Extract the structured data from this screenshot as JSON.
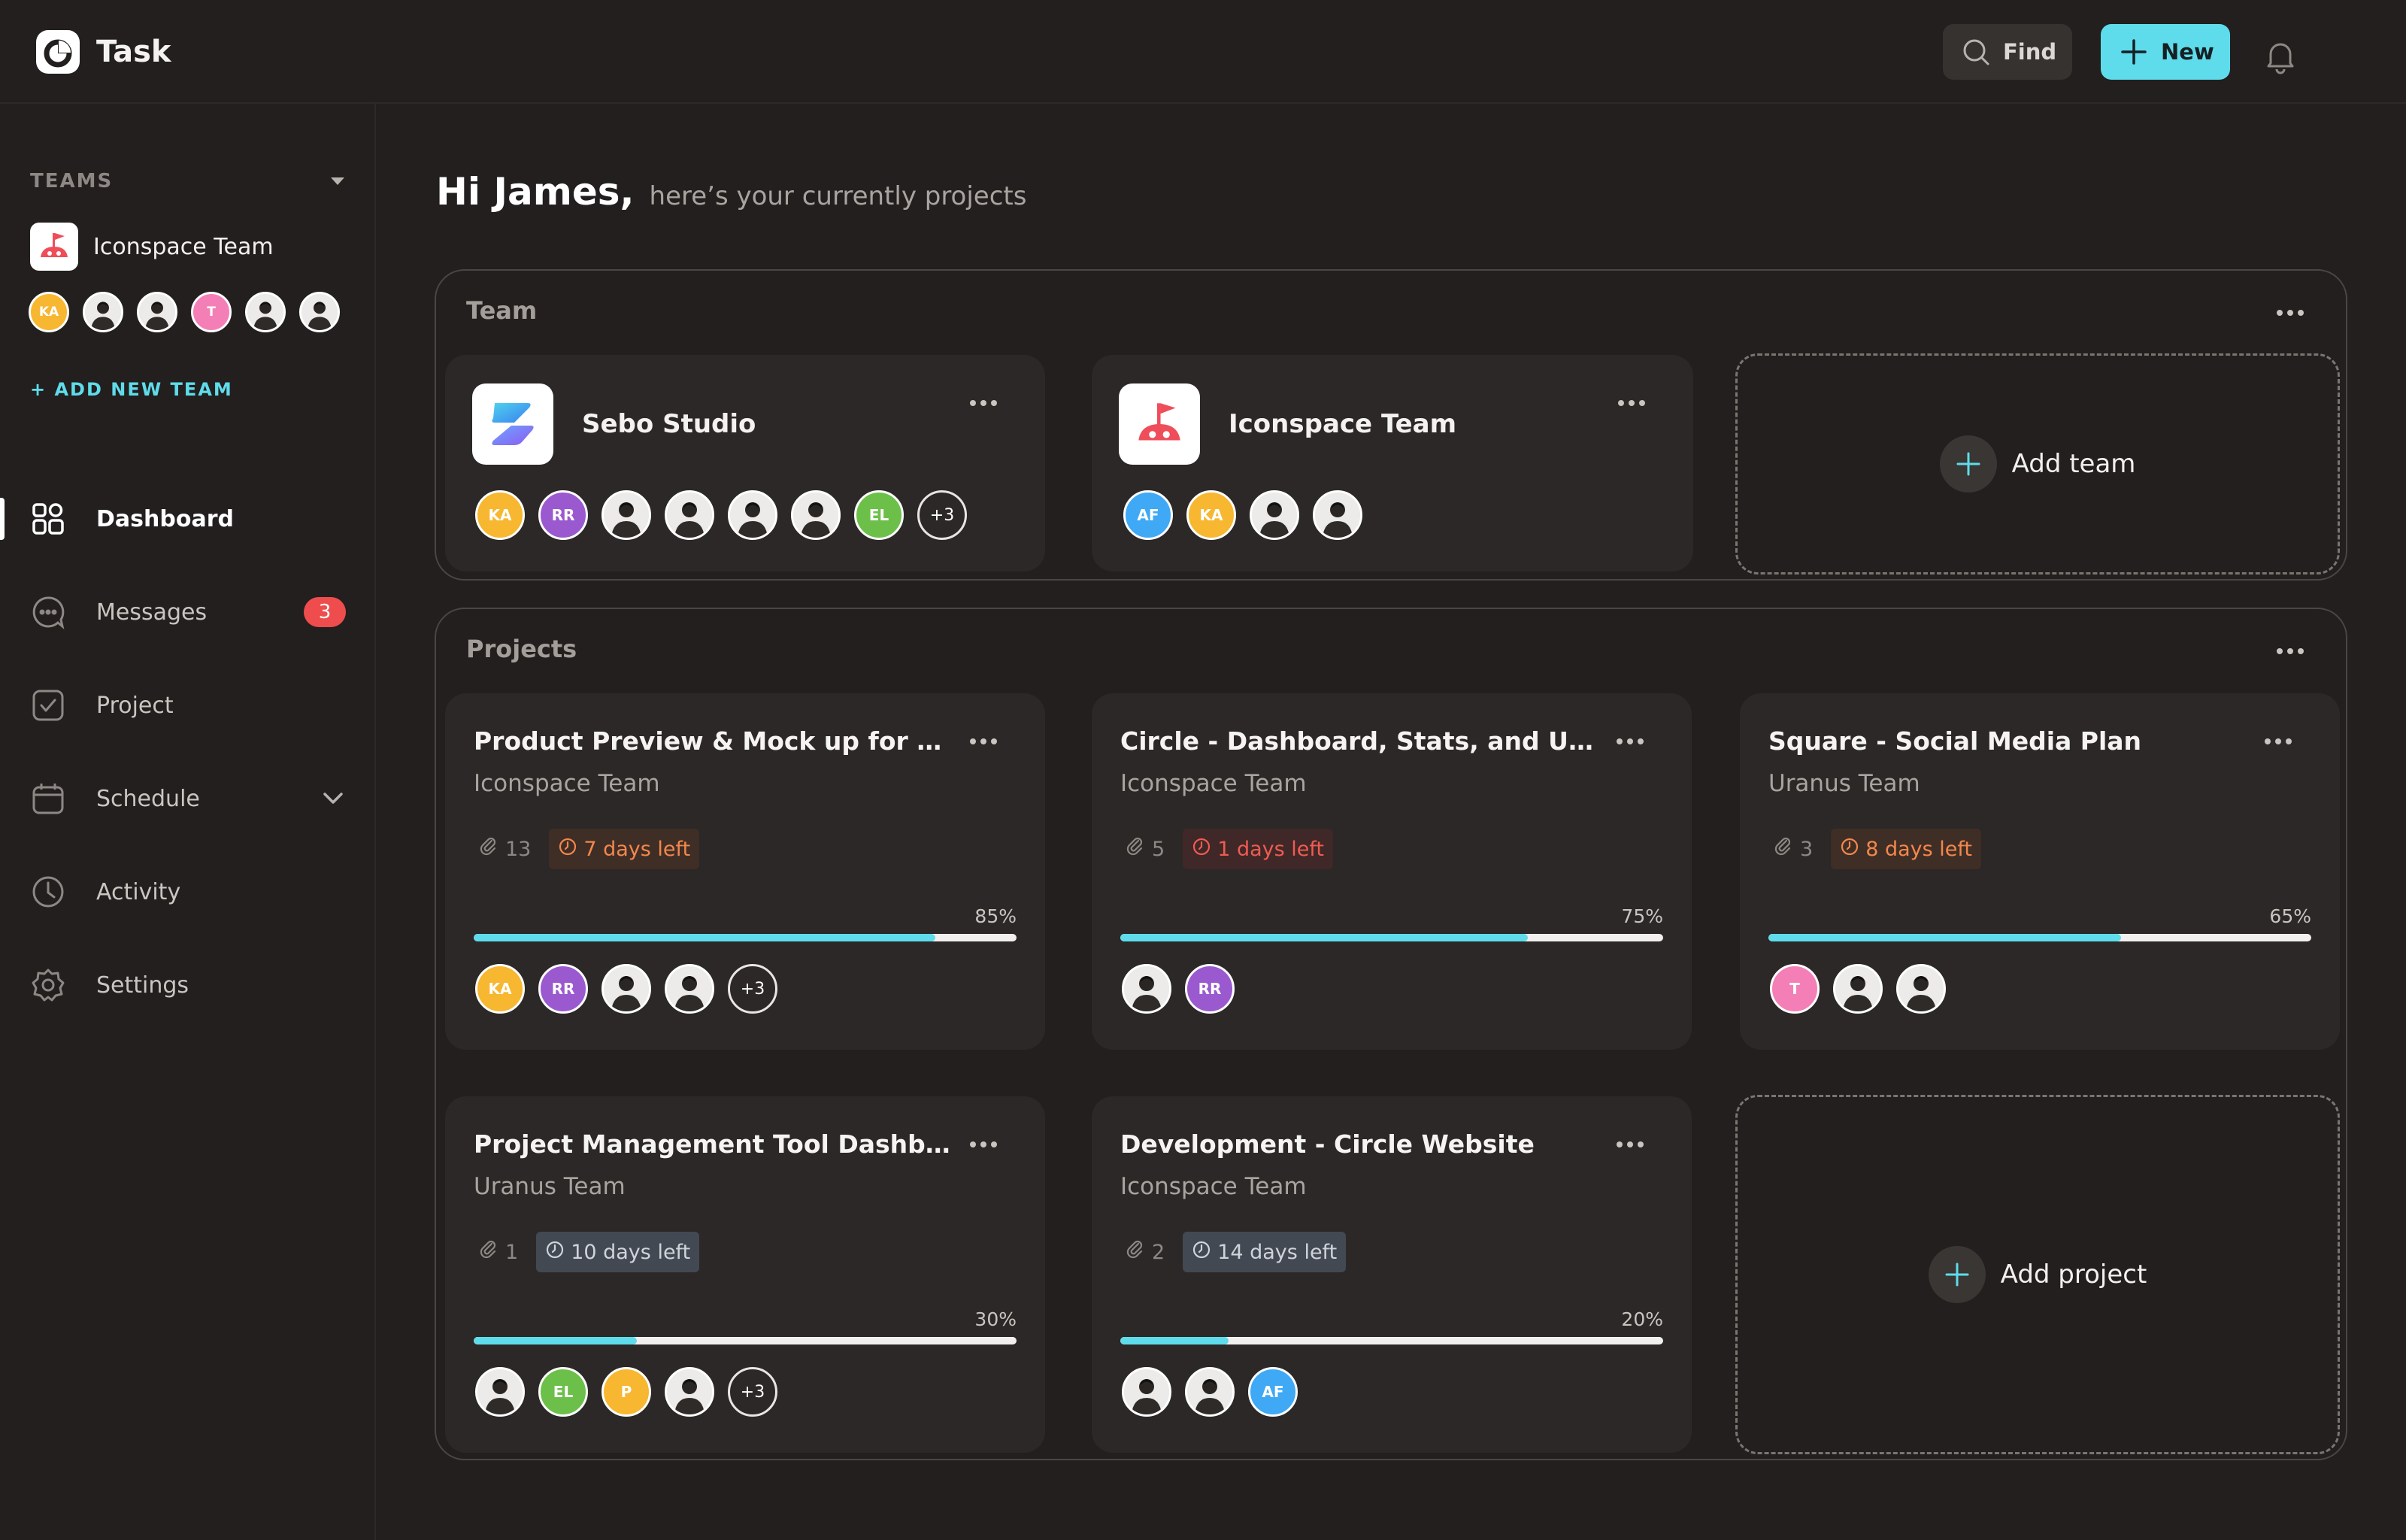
{
  "app": {
    "name": "Task"
  },
  "topbar": {
    "find_label": "Find",
    "new_label": "New"
  },
  "sidebar": {
    "teams_heading": "TEAMS",
    "team": {
      "name": "Iconspace Team",
      "avatars": [
        {
          "type": "initials",
          "text": "KA",
          "color": "#f7b731"
        },
        {
          "type": "photo"
        },
        {
          "type": "photo"
        },
        {
          "type": "initials",
          "text": "T",
          "color": "#f47fb6"
        },
        {
          "type": "photo"
        },
        {
          "type": "photo"
        }
      ]
    },
    "add_team": "+ ADD NEW TEAM",
    "nav": [
      {
        "label": "Dashboard",
        "icon": "dashboard-icon",
        "active": true
      },
      {
        "label": "Messages",
        "icon": "messages-icon",
        "badge": "3"
      },
      {
        "label": "Project",
        "icon": "project-icon"
      },
      {
        "label": "Schedule",
        "icon": "schedule-icon",
        "chevron": true
      },
      {
        "label": "Activity",
        "icon": "activity-icon"
      },
      {
        "label": "Settings",
        "icon": "settings-icon"
      }
    ]
  },
  "greeting": {
    "hi": "Hi James,",
    "sub": "here’s your currently projects"
  },
  "team_section": {
    "title": "Team",
    "teams": [
      {
        "name": "Sebo Studio",
        "avatars": [
          {
            "type": "initials",
            "text": "KA",
            "color": "#f7b731"
          },
          {
            "type": "initials",
            "text": "RR",
            "color": "#9b59d0"
          },
          {
            "type": "photo"
          },
          {
            "type": "photo"
          },
          {
            "type": "photo"
          },
          {
            "type": "photo"
          },
          {
            "type": "initials",
            "text": "EL",
            "color": "#6cc04a"
          },
          {
            "type": "more",
            "text": "+3"
          }
        ]
      },
      {
        "name": "Iconspace Team",
        "avatars": [
          {
            "type": "initials",
            "text": "AF",
            "color": "#3fa9f5"
          },
          {
            "type": "initials",
            "text": "KA",
            "color": "#f7b731"
          },
          {
            "type": "photo"
          },
          {
            "type": "photo"
          }
        ]
      }
    ],
    "add_label": "Add team"
  },
  "projects_section": {
    "title": "Projects",
    "projects": [
      {
        "title": "Product Preview & Mock up for Marketing Project",
        "team": "Iconspace Team",
        "attachments": "13",
        "deadline": "7 days left",
        "deadline_status": "warn",
        "progress_label": "85%",
        "progress": 0.85,
        "avatars": [
          {
            "type": "initials",
            "text": "KA",
            "color": "#f7b731"
          },
          {
            "type": "initials",
            "text": "RR",
            "color": "#9b59d0"
          },
          {
            "type": "photo"
          },
          {
            "type": "photo"
          },
          {
            "type": "more",
            "text": "+3"
          }
        ]
      },
      {
        "title": "Circle - Dashboard, Stats, and UI Kit",
        "team": "Iconspace Team",
        "attachments": "5",
        "deadline": "1 days left",
        "deadline_status": "danger",
        "progress_label": "75%",
        "progress": 0.75,
        "avatars": [
          {
            "type": "photo"
          },
          {
            "type": "initials",
            "text": "RR",
            "color": "#9b59d0"
          }
        ]
      },
      {
        "title": "Square - Social Media Plan",
        "team": "Uranus Team",
        "attachments": "3",
        "deadline": "8 days left",
        "deadline_status": "warn",
        "progress_label": "65%",
        "progress": 0.65,
        "avatars": [
          {
            "type": "initials",
            "text": "T",
            "color": "#f47fb6"
          },
          {
            "type": "photo"
          },
          {
            "type": "photo"
          }
        ]
      },
      {
        "title": "Project Management Tool Dashboard",
        "team": "Uranus Team",
        "attachments": "1",
        "deadline": "10 days left",
        "deadline_status": "neutral",
        "progress_label": "30%",
        "progress": 0.3,
        "avatars": [
          {
            "type": "photo"
          },
          {
            "type": "initials",
            "text": "EL",
            "color": "#6cc04a"
          },
          {
            "type": "initials",
            "text": "P",
            "color": "#f7b731"
          },
          {
            "type": "photo"
          },
          {
            "type": "more",
            "text": "+3"
          }
        ]
      },
      {
        "title": "Development - Circle Website",
        "team": "Iconspace Team",
        "attachments": "2",
        "deadline": "14 days left",
        "deadline_status": "neutral",
        "progress_label": "20%",
        "progress": 0.2,
        "avatars": [
          {
            "type": "photo"
          },
          {
            "type": "photo"
          },
          {
            "type": "initials",
            "text": "AF",
            "color": "#3fa9f5"
          }
        ]
      }
    ],
    "add_label": "Add project"
  }
}
